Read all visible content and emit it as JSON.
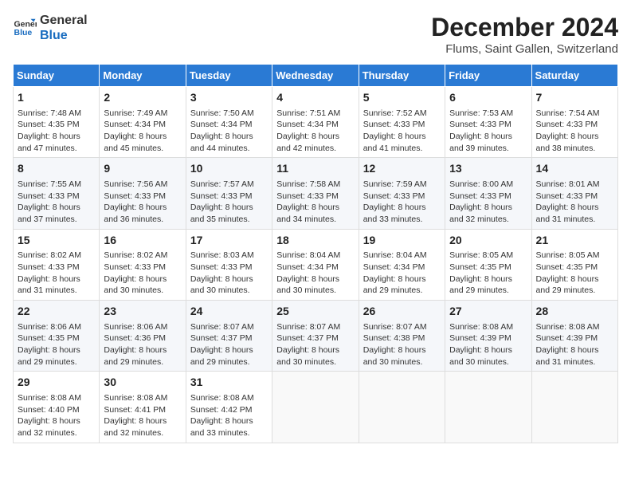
{
  "logo": {
    "general": "General",
    "blue": "Blue"
  },
  "title": "December 2024",
  "subtitle": "Flums, Saint Gallen, Switzerland",
  "days_of_week": [
    "Sunday",
    "Monday",
    "Tuesday",
    "Wednesday",
    "Thursday",
    "Friday",
    "Saturday"
  ],
  "weeks": [
    [
      {
        "day": "1",
        "sunrise": "Sunrise: 7:48 AM",
        "sunset": "Sunset: 4:35 PM",
        "daylight": "Daylight: 8 hours and 47 minutes."
      },
      {
        "day": "2",
        "sunrise": "Sunrise: 7:49 AM",
        "sunset": "Sunset: 4:34 PM",
        "daylight": "Daylight: 8 hours and 45 minutes."
      },
      {
        "day": "3",
        "sunrise": "Sunrise: 7:50 AM",
        "sunset": "Sunset: 4:34 PM",
        "daylight": "Daylight: 8 hours and 44 minutes."
      },
      {
        "day": "4",
        "sunrise": "Sunrise: 7:51 AM",
        "sunset": "Sunset: 4:34 PM",
        "daylight": "Daylight: 8 hours and 42 minutes."
      },
      {
        "day": "5",
        "sunrise": "Sunrise: 7:52 AM",
        "sunset": "Sunset: 4:33 PM",
        "daylight": "Daylight: 8 hours and 41 minutes."
      },
      {
        "day": "6",
        "sunrise": "Sunrise: 7:53 AM",
        "sunset": "Sunset: 4:33 PM",
        "daylight": "Daylight: 8 hours and 39 minutes."
      },
      {
        "day": "7",
        "sunrise": "Sunrise: 7:54 AM",
        "sunset": "Sunset: 4:33 PM",
        "daylight": "Daylight: 8 hours and 38 minutes."
      }
    ],
    [
      {
        "day": "8",
        "sunrise": "Sunrise: 7:55 AM",
        "sunset": "Sunset: 4:33 PM",
        "daylight": "Daylight: 8 hours and 37 minutes."
      },
      {
        "day": "9",
        "sunrise": "Sunrise: 7:56 AM",
        "sunset": "Sunset: 4:33 PM",
        "daylight": "Daylight: 8 hours and 36 minutes."
      },
      {
        "day": "10",
        "sunrise": "Sunrise: 7:57 AM",
        "sunset": "Sunset: 4:33 PM",
        "daylight": "Daylight: 8 hours and 35 minutes."
      },
      {
        "day": "11",
        "sunrise": "Sunrise: 7:58 AM",
        "sunset": "Sunset: 4:33 PM",
        "daylight": "Daylight: 8 hours and 34 minutes."
      },
      {
        "day": "12",
        "sunrise": "Sunrise: 7:59 AM",
        "sunset": "Sunset: 4:33 PM",
        "daylight": "Daylight: 8 hours and 33 minutes."
      },
      {
        "day": "13",
        "sunrise": "Sunrise: 8:00 AM",
        "sunset": "Sunset: 4:33 PM",
        "daylight": "Daylight: 8 hours and 32 minutes."
      },
      {
        "day": "14",
        "sunrise": "Sunrise: 8:01 AM",
        "sunset": "Sunset: 4:33 PM",
        "daylight": "Daylight: 8 hours and 31 minutes."
      }
    ],
    [
      {
        "day": "15",
        "sunrise": "Sunrise: 8:02 AM",
        "sunset": "Sunset: 4:33 PM",
        "daylight": "Daylight: 8 hours and 31 minutes."
      },
      {
        "day": "16",
        "sunrise": "Sunrise: 8:02 AM",
        "sunset": "Sunset: 4:33 PM",
        "daylight": "Daylight: 8 hours and 30 minutes."
      },
      {
        "day": "17",
        "sunrise": "Sunrise: 8:03 AM",
        "sunset": "Sunset: 4:33 PM",
        "daylight": "Daylight: 8 hours and 30 minutes."
      },
      {
        "day": "18",
        "sunrise": "Sunrise: 8:04 AM",
        "sunset": "Sunset: 4:34 PM",
        "daylight": "Daylight: 8 hours and 30 minutes."
      },
      {
        "day": "19",
        "sunrise": "Sunrise: 8:04 AM",
        "sunset": "Sunset: 4:34 PM",
        "daylight": "Daylight: 8 hours and 29 minutes."
      },
      {
        "day": "20",
        "sunrise": "Sunrise: 8:05 AM",
        "sunset": "Sunset: 4:35 PM",
        "daylight": "Daylight: 8 hours and 29 minutes."
      },
      {
        "day": "21",
        "sunrise": "Sunrise: 8:05 AM",
        "sunset": "Sunset: 4:35 PM",
        "daylight": "Daylight: 8 hours and 29 minutes."
      }
    ],
    [
      {
        "day": "22",
        "sunrise": "Sunrise: 8:06 AM",
        "sunset": "Sunset: 4:35 PM",
        "daylight": "Daylight: 8 hours and 29 minutes."
      },
      {
        "day": "23",
        "sunrise": "Sunrise: 8:06 AM",
        "sunset": "Sunset: 4:36 PM",
        "daylight": "Daylight: 8 hours and 29 minutes."
      },
      {
        "day": "24",
        "sunrise": "Sunrise: 8:07 AM",
        "sunset": "Sunset: 4:37 PM",
        "daylight": "Daylight: 8 hours and 29 minutes."
      },
      {
        "day": "25",
        "sunrise": "Sunrise: 8:07 AM",
        "sunset": "Sunset: 4:37 PM",
        "daylight": "Daylight: 8 hours and 30 minutes."
      },
      {
        "day": "26",
        "sunrise": "Sunrise: 8:07 AM",
        "sunset": "Sunset: 4:38 PM",
        "daylight": "Daylight: 8 hours and 30 minutes."
      },
      {
        "day": "27",
        "sunrise": "Sunrise: 8:08 AM",
        "sunset": "Sunset: 4:39 PM",
        "daylight": "Daylight: 8 hours and 30 minutes."
      },
      {
        "day": "28",
        "sunrise": "Sunrise: 8:08 AM",
        "sunset": "Sunset: 4:39 PM",
        "daylight": "Daylight: 8 hours and 31 minutes."
      }
    ],
    [
      {
        "day": "29",
        "sunrise": "Sunrise: 8:08 AM",
        "sunset": "Sunset: 4:40 PM",
        "daylight": "Daylight: 8 hours and 32 minutes."
      },
      {
        "day": "30",
        "sunrise": "Sunrise: 8:08 AM",
        "sunset": "Sunset: 4:41 PM",
        "daylight": "Daylight: 8 hours and 32 minutes."
      },
      {
        "day": "31",
        "sunrise": "Sunrise: 8:08 AM",
        "sunset": "Sunset: 4:42 PM",
        "daylight": "Daylight: 8 hours and 33 minutes."
      },
      null,
      null,
      null,
      null
    ]
  ]
}
